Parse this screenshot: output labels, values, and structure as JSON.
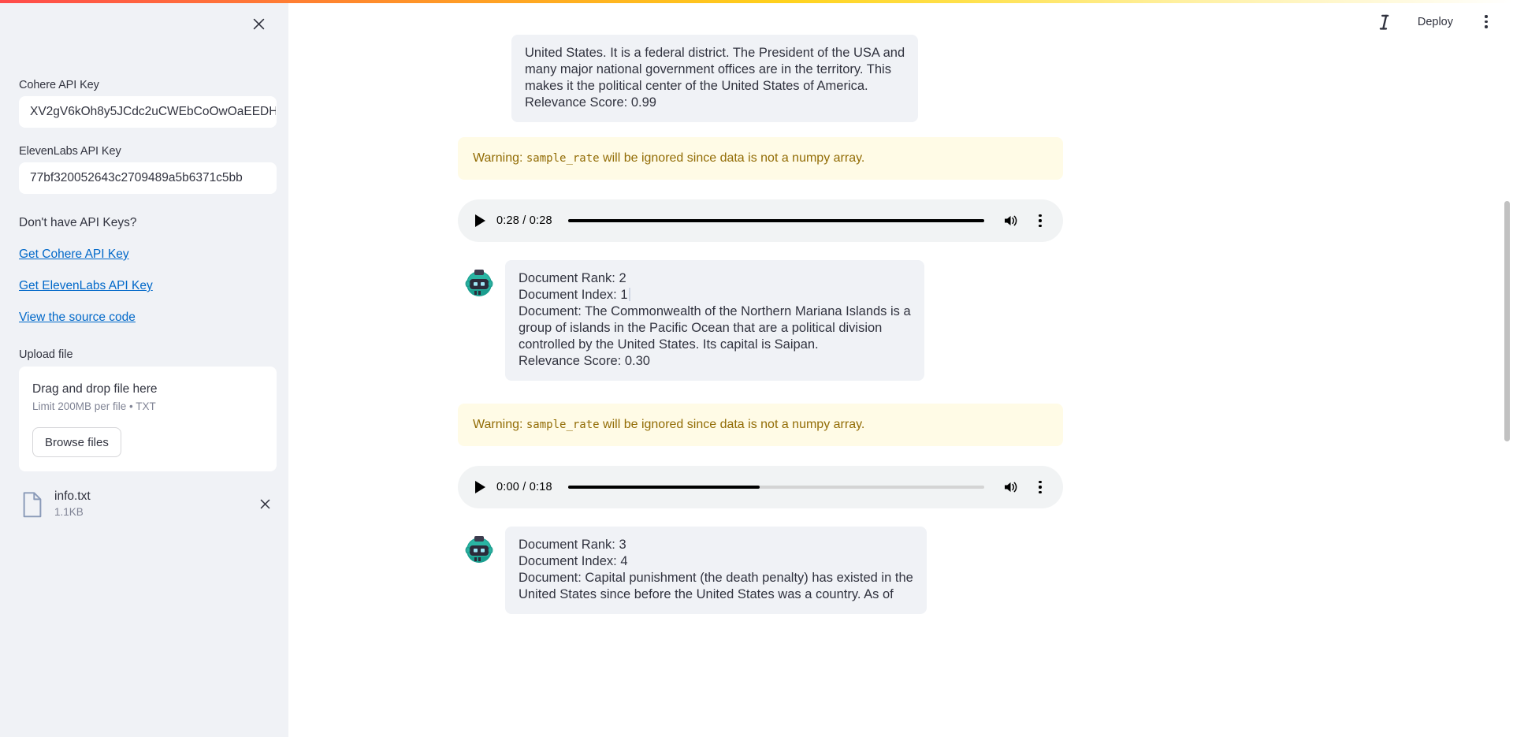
{
  "sidebar": {
    "close_label": "close",
    "cohere_label": "Cohere API Key",
    "cohere_value": "XV2gV6kOh8y5JCdc2uCWEbCoOwOaEEDH",
    "elevenlabs_label": "ElevenLabs API Key",
    "elevenlabs_value": "77bf320052643c2709489a5b6371c5bb",
    "help_title": "Don't have API Keys?",
    "links": [
      {
        "label": "Get Cohere API Key"
      },
      {
        "label": "Get ElevenLabs API Key"
      },
      {
        "label": "View the source code"
      }
    ],
    "upload_label": "Upload file",
    "dropzone": {
      "title": "Drag and drop file here",
      "subtitle": "Limit 200MB per file • TXT",
      "browse_label": "Browse files"
    },
    "file": {
      "name": "info.txt",
      "size": "1.1KB"
    }
  },
  "header": {
    "info_icon": "info-italic-icon",
    "deploy_label": "Deploy",
    "menu_icon": "kebab-menu-icon"
  },
  "main": {
    "messages": [
      {
        "type": "bubble",
        "lines": [
          "United States. It is a federal district. The President of the USA and",
          "many major national government offices are in the territory. This",
          "makes it the political center of the United States of America.",
          "Relevance Score: 0.99"
        ]
      },
      {
        "type": "warning",
        "prefix": "Warning: ",
        "code": "sample_rate",
        "suffix": " will be ignored since data is not a numpy array."
      },
      {
        "type": "audio",
        "current_time": "0:28",
        "total_time": "0:28",
        "time_display": "0:28 / 0:28",
        "progress_percent": 100
      },
      {
        "type": "bubble_avatar",
        "avatar": "robot-avatar",
        "lines": [
          "Document Rank: 2",
          "Document Index: 1",
          "Document: The Commonwealth of the Northern Mariana Islands is a",
          "group of islands in the Pacific Ocean that are a political division",
          "controlled by the United States. Its capital is Saipan.",
          "Relevance Score: 0.30"
        ]
      },
      {
        "type": "warning",
        "prefix": "Warning: ",
        "code": "sample_rate",
        "suffix": " will be ignored since data is not a numpy array."
      },
      {
        "type": "audio",
        "current_time": "0:00",
        "total_time": "0:18",
        "time_display": "0:00 / 0:18",
        "progress_percent": 46
      },
      {
        "type": "bubble_avatar",
        "avatar": "robot-avatar",
        "lines": [
          "Document Rank: 3",
          "Document Index: 4",
          "Document: Capital punishment (the death penalty) has existed in the",
          "United States since before the United States was a country. As of"
        ]
      }
    ]
  },
  "colors": {
    "sidebar_bg": "#f0f2f6",
    "bubble_bg": "#f0f2f6",
    "warning_bg": "#fffbe6",
    "warning_text": "#926c05",
    "link": "#0068c9",
    "text": "#31333f"
  }
}
